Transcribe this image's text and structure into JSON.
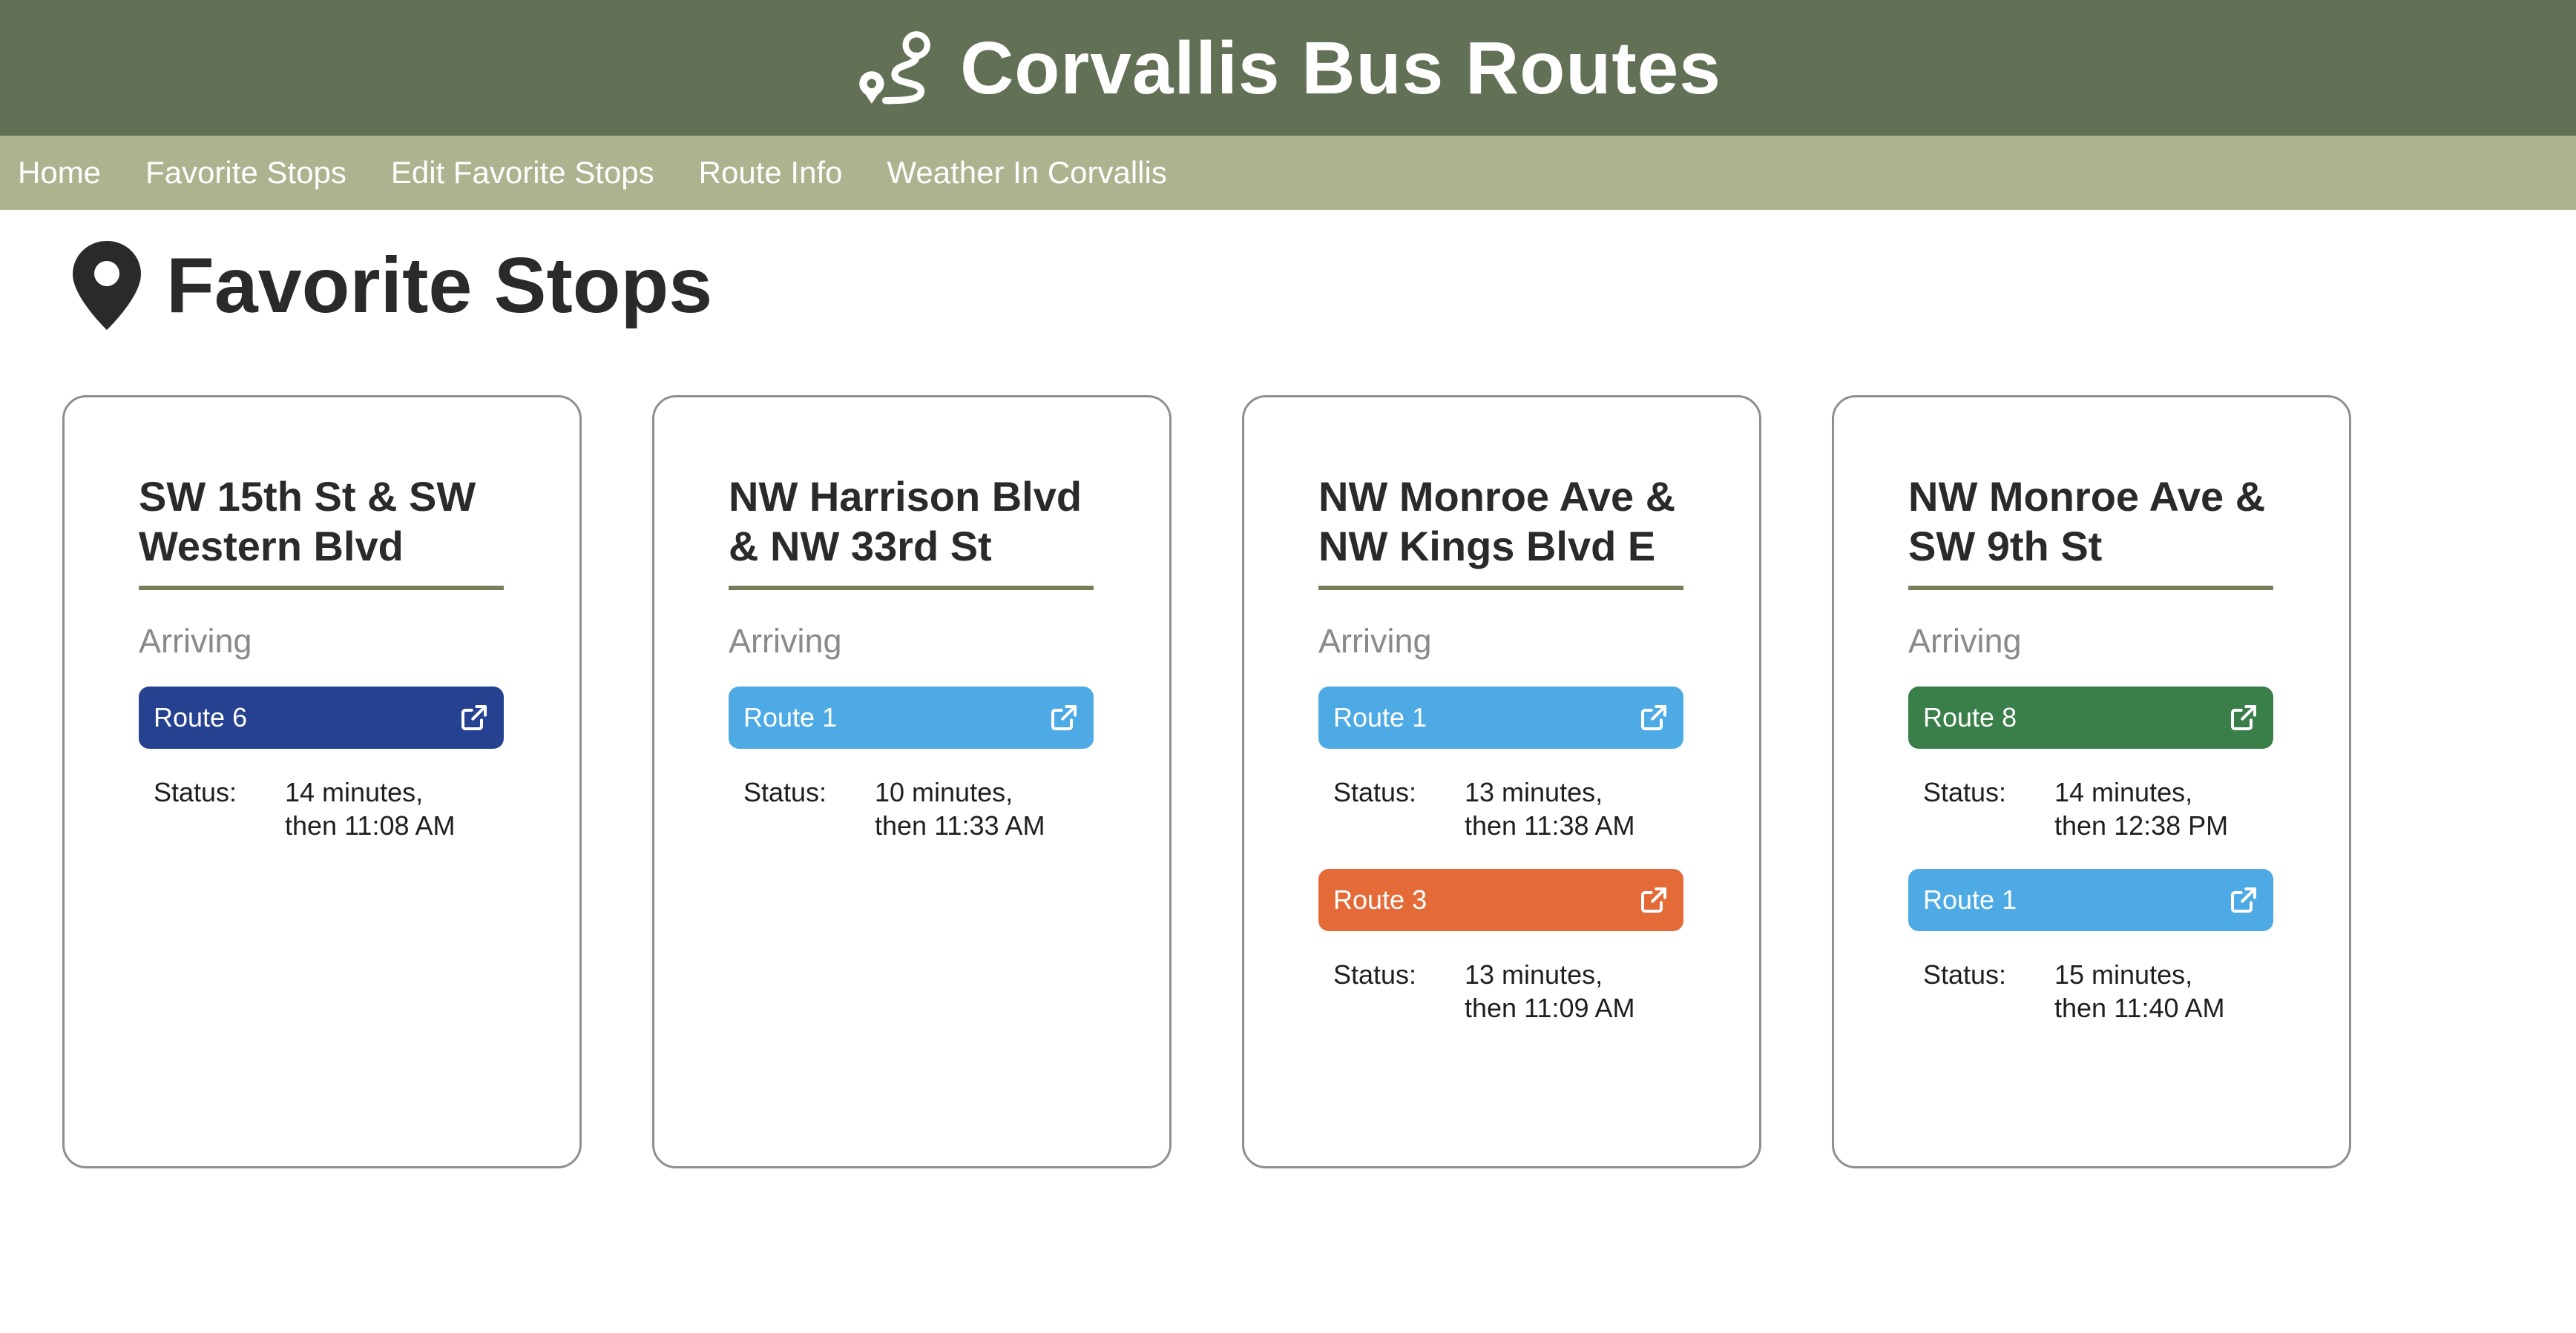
{
  "header": {
    "title": "Corvallis Bus Routes",
    "icon": "route-icon"
  },
  "nav": {
    "items": [
      {
        "label": "Home"
      },
      {
        "label": "Favorite Stops"
      },
      {
        "label": "Edit Favorite Stops"
      },
      {
        "label": "Route Info"
      },
      {
        "label": "Weather In Corvallis"
      }
    ]
  },
  "page": {
    "title": "Favorite Stops",
    "icon": "map-pin-icon"
  },
  "colors": {
    "header_bg": "#627055",
    "nav_bg": "#abb48e",
    "route_navy": "#26418f",
    "route_lightblue": "#4eaae5",
    "route_orange": "#e46b38",
    "route_green": "#3a7e4a"
  },
  "cards": [
    {
      "stop": "SW 15th St & SW Western Blvd",
      "arriving_label": "Arriving",
      "routes": [
        {
          "label": "Route 6",
          "color": "#26418f",
          "status_label": "Status:",
          "status_line1": "14 minutes,",
          "status_line2": "then 11:08 AM"
        }
      ]
    },
    {
      "stop": "NW Harrison Blvd & NW 33rd St",
      "arriving_label": "Arriving",
      "routes": [
        {
          "label": "Route 1",
          "color": "#4eaae5",
          "status_label": "Status:",
          "status_line1": "10 minutes,",
          "status_line2": "then 11:33 AM"
        }
      ]
    },
    {
      "stop": "NW Monroe Ave & NW Kings Blvd E",
      "arriving_label": "Arriving",
      "routes": [
        {
          "label": "Route 1",
          "color": "#4eaae5",
          "status_label": "Status:",
          "status_line1": "13 minutes,",
          "status_line2": "then 11:38 AM"
        },
        {
          "label": "Route 3",
          "color": "#e46b38",
          "status_label": "Status:",
          "status_line1": "13 minutes,",
          "status_line2": "then 11:09 AM"
        }
      ]
    },
    {
      "stop": "NW Monroe Ave & SW 9th St",
      "arriving_label": "Arriving",
      "routes": [
        {
          "label": "Route 8",
          "color": "#3a7e4a",
          "status_label": "Status:",
          "status_line1": "14 minutes,",
          "status_line2": "then 12:38 PM"
        },
        {
          "label": "Route 1",
          "color": "#4eaae5",
          "status_label": "Status:",
          "status_line1": "15 minutes,",
          "status_line2": "then 11:40 AM"
        }
      ]
    }
  ]
}
